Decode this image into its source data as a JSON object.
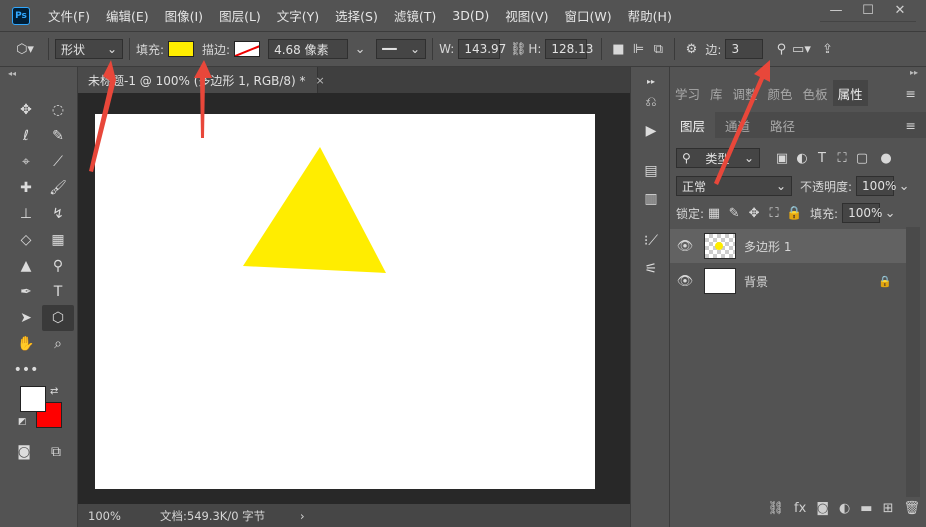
{
  "app": {
    "logo": "Ps"
  },
  "menu": [
    "文件(F)",
    "编辑(E)",
    "图像(I)",
    "图层(L)",
    "文字(Y)",
    "选择(S)",
    "滤镜(T)",
    "3D(D)",
    "视图(V)",
    "窗口(W)",
    "帮助(H)"
  ],
  "window_controls": {
    "minimize": "—",
    "maximize": "☐",
    "close": "✕"
  },
  "options": {
    "mode_value": "形状",
    "fill_label": "填充:",
    "fill_color": "#ffed00",
    "stroke_label": "描边:",
    "stroke_width": "4.68 像素",
    "w_label": "W:",
    "w_value": "143.97",
    "h_label": "H:",
    "h_value": "128.13",
    "sides_label": "边:",
    "sides_value": "3"
  },
  "document": {
    "tab_title": "未标题-1 @ 100% (多边形 1, RGB/8) *",
    "tab_close": "×",
    "shape_color": "#ffed00",
    "zoom": "100%",
    "doc_info": "文档:549.3K/0 字节",
    "status_arrow": "›"
  },
  "colors": {
    "foreground": "#ffffff",
    "background": "#ff0000"
  },
  "panel_tabs": [
    {
      "label": "学习",
      "active": false
    },
    {
      "label": "库",
      "active": false
    },
    {
      "label": "调整",
      "active": false
    },
    {
      "label": "颜色",
      "active": false
    },
    {
      "label": "色板",
      "active": false
    },
    {
      "label": "属性",
      "active": true
    }
  ],
  "layers_panel": {
    "tabs": [
      {
        "label": "图层",
        "active": true
      },
      {
        "label": "通道",
        "active": false
      },
      {
        "label": "路径",
        "active": false
      }
    ],
    "filter_kind": "类型",
    "blend_mode": "正常",
    "opacity_label": "不透明度:",
    "opacity_value": "100%",
    "lock_label": "锁定:",
    "fill_label": "填充:",
    "fill_value": "100%",
    "layers": [
      {
        "name": "多边形 1",
        "selected": true
      },
      {
        "name": "背景",
        "selected": false
      }
    ]
  }
}
